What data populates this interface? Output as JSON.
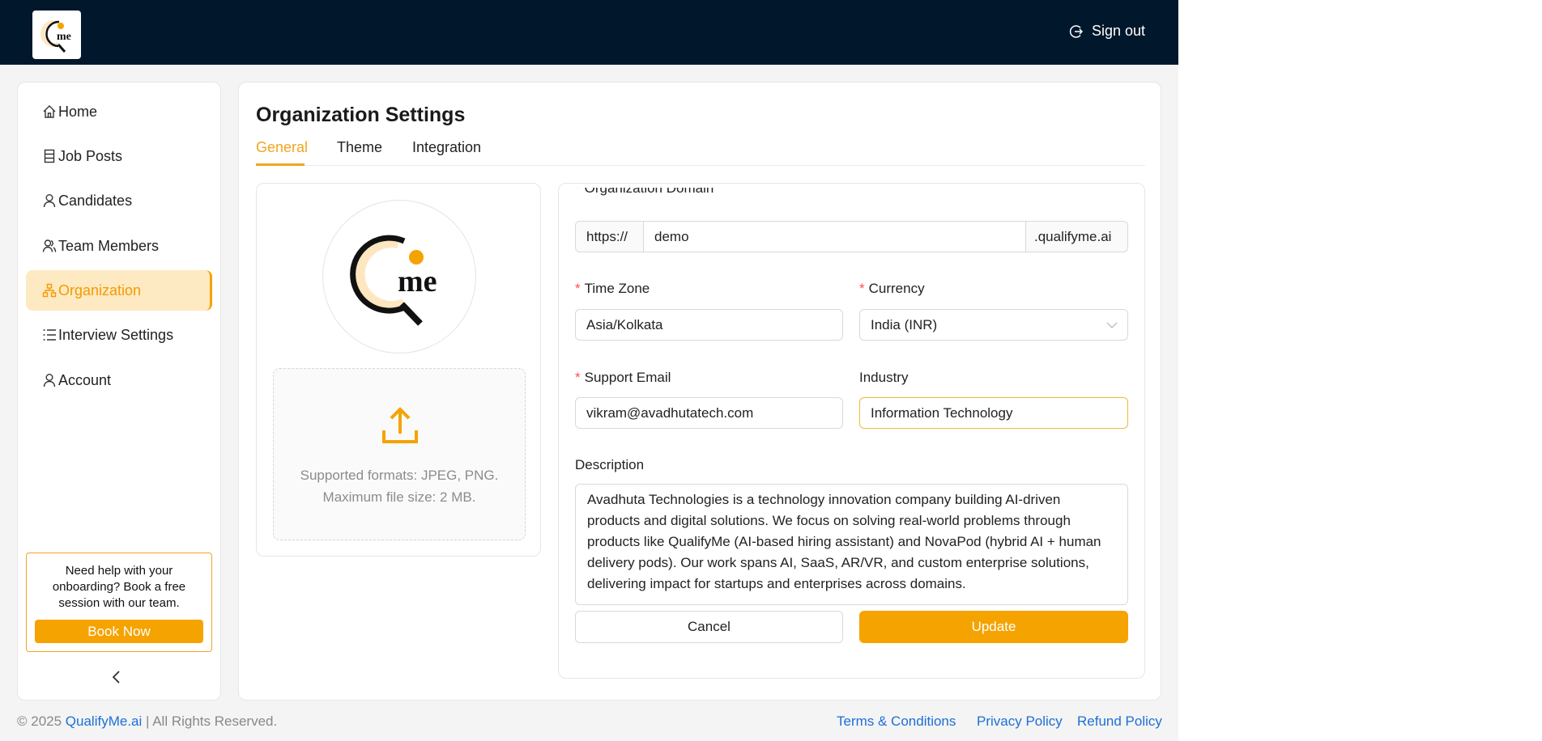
{
  "header": {
    "logo_text": "me",
    "signout_label": "Sign out"
  },
  "sidebar": {
    "items": [
      {
        "label": "Home",
        "icon": "home-icon"
      },
      {
        "label": "Job Posts",
        "icon": "document-icon"
      },
      {
        "label": "Candidates",
        "icon": "user-icon"
      },
      {
        "label": "Team Members",
        "icon": "team-icon"
      },
      {
        "label": "Organization",
        "icon": "org-chart-icon",
        "active": true
      },
      {
        "label": "Interview Settings",
        "icon": "list-icon"
      },
      {
        "label": "Account",
        "icon": "user-icon"
      }
    ],
    "help_text": "Need help with your onboarding? Book a free session with our team.",
    "book_label": "Book Now"
  },
  "main": {
    "title": "Organization Settings",
    "tabs": [
      {
        "label": "General",
        "active": true
      },
      {
        "label": "Theme"
      },
      {
        "label": "Integration"
      }
    ],
    "upload": {
      "line1": "Supported formats: JPEG, PNG.",
      "line2": "Maximum file size: 2 MB."
    },
    "form": {
      "domain": {
        "label": "Organization Domain",
        "prefix": "https://",
        "value": "demo",
        "suffix": ".qualifyme.ai"
      },
      "timezone": {
        "label": "Time Zone",
        "value": "Asia/Kolkata"
      },
      "currency": {
        "label": "Currency",
        "value": "India (INR)"
      },
      "email": {
        "label": "Support Email",
        "value": "vikram@avadhutatech.com"
      },
      "industry": {
        "label": "Industry",
        "value": "Information Technology"
      },
      "description": {
        "label": "Description",
        "value": "Avadhuta Technologies is a technology innovation company building AI-driven products and digital solutions. We focus on solving real-world problems through products like QualifyMe (AI-based hiring assistant) and NovaPod (hybrid AI + human delivery pods). Our work spans AI, SaaS, AR/VR, and custom enterprise solutions, delivering impact for startups and enterprises across domains."
      },
      "cancel_label": "Cancel",
      "update_label": "Update"
    }
  },
  "footer": {
    "copyright_prefix": "© 2025 ",
    "brand": "QualifyMe.ai",
    "copyright_suffix": " | All Rights Reserved.",
    "links": [
      "Terms & Conditions",
      "Privacy Policy",
      "Refund Policy"
    ]
  },
  "colors": {
    "accent": "#f5a300",
    "header_bg": "#01172c",
    "link": "#1d6fd6"
  }
}
